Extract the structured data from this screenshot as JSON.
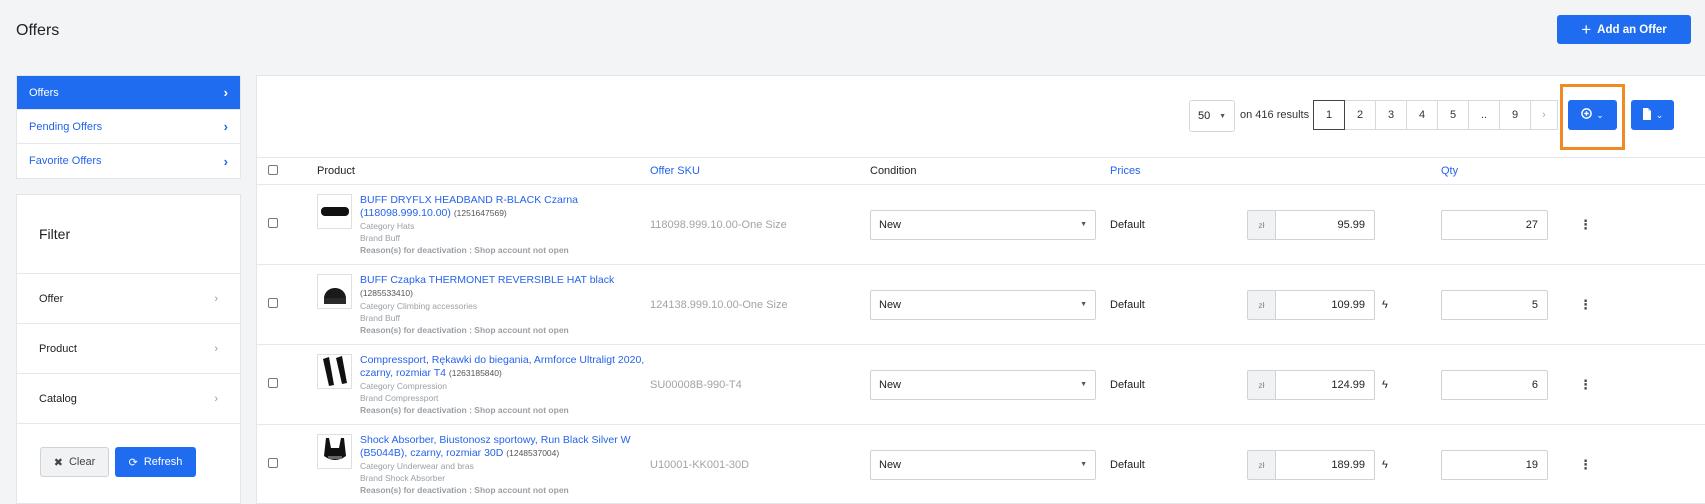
{
  "page": {
    "title": "Offers",
    "add_button": "Add an Offer"
  },
  "side_nav": [
    {
      "label": "Offers"
    },
    {
      "label": "Pending Offers"
    },
    {
      "label": "Favorite Offers"
    }
  ],
  "filter": {
    "title": "Filter",
    "rows": [
      {
        "label": "Offer"
      },
      {
        "label": "Product"
      },
      {
        "label": "Catalog"
      }
    ],
    "clear_label": "Clear",
    "refresh_label": "Refresh"
  },
  "toolbar": {
    "per_page": "50",
    "results_text": "on 416 results",
    "pages": [
      "1",
      "2",
      "3",
      "4",
      "5",
      "..",
      "9"
    ],
    "next_glyph": "›"
  },
  "table": {
    "headers": {
      "product": "Product",
      "sku": "Offer SKU",
      "condition": "Condition",
      "prices": "Prices",
      "qty": "Qty"
    },
    "rows": [
      {
        "name": "BUFF DRYFLX HEADBAND R-BLACK Czarna (118098.999.10.00)",
        "id": "(1251647569)",
        "category": "Category Hats",
        "brand": "Brand Buff",
        "reason": "Reason(s) for deactivation : Shop account not open",
        "sku": "118098.999.10.00-One Size",
        "condition": "New",
        "price_label": "Default",
        "currency": "zł",
        "price": "95.99",
        "bolt": "",
        "qty": "27",
        "thumb": "headband"
      },
      {
        "name": "BUFF Czapka THERMONET REVERSIBLE HAT black",
        "id": "(1285533410)",
        "category": "Category Climbing accessories",
        "brand": "Brand Buff",
        "reason": "Reason(s) for deactivation : Shop account not open",
        "sku": "124138.999.10.00-One Size",
        "condition": "New",
        "price_label": "Default",
        "currency": "zł",
        "price": "109.99",
        "bolt": "ϟ",
        "qty": "5",
        "thumb": "hat"
      },
      {
        "name": "Compressport, Rękawki do biegania, Armforce Ultraligt 2020, czarny, rozmiar T4",
        "id": "(1263185840)",
        "category": "Category Compression",
        "brand": "Brand Compressport",
        "reason": "Reason(s) for deactivation : Shop account not open",
        "sku": "SU00008B-990-T4",
        "condition": "New",
        "price_label": "Default",
        "currency": "zł",
        "price": "124.99",
        "bolt": "ϟ",
        "qty": "6",
        "thumb": "sleeves"
      },
      {
        "name": "Shock Absorber, Biustonosz sportowy, Run Black Silver W (B5044B), czarny, rozmiar 30D",
        "id": "(1248537004)",
        "category": "Category Underwear and bras",
        "brand": "Brand Shock Absorber",
        "reason": "Reason(s) for deactivation : Shop account not open",
        "sku": "U10001-KK001-30D",
        "condition": "New",
        "price_label": "Default",
        "currency": "zł",
        "price": "189.99",
        "bolt": "ϟ",
        "qty": "19",
        "thumb": "bra"
      }
    ]
  },
  "colors": {
    "accent": "#1f6cf0",
    "link": "#2563eb",
    "highlight": "#f08a24"
  }
}
